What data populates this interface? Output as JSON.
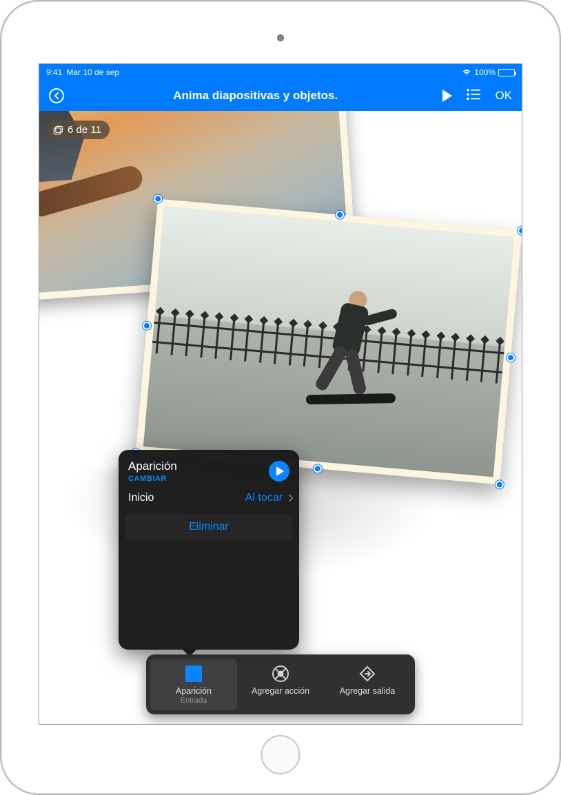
{
  "status": {
    "time": "9:41",
    "date": "Mar 10 de sep",
    "battery_pct": "100%"
  },
  "toolbar": {
    "title": "Anima diapositivas y objetos.",
    "ok_label": "OK"
  },
  "slide_indicator": {
    "text": "6 de 11"
  },
  "popover": {
    "title": "Aparición",
    "change_label": "CAMBIAR",
    "start_label": "Inicio",
    "start_value": "Al tocar",
    "delete_label": "Eliminar"
  },
  "actionbar": {
    "item1_label": "Aparición",
    "item1_sub": "Entrada",
    "item2_label": "Agregar acción",
    "item3_label": "Agregar salida"
  }
}
